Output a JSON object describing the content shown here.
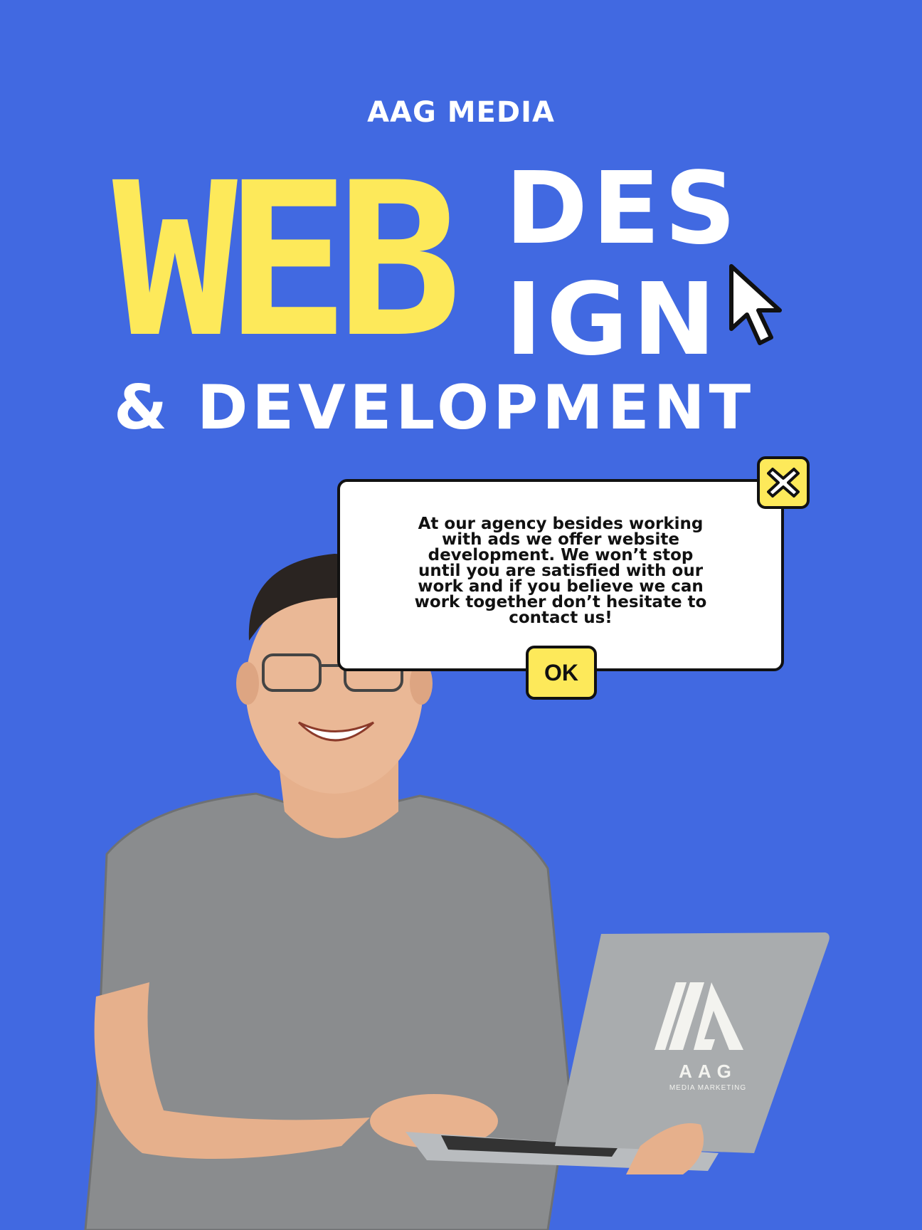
{
  "brand": "AAG MEDIA",
  "headline": {
    "word1": "WEB",
    "word2_part1": "DES",
    "word2_part2": "IGN",
    "line3": "& DEVELOPMENT"
  },
  "dialog": {
    "message": "At our agency besides working with ads we offer website development. We won’t stop until you are satisfied with our work and if you believe we can work together don’t hesitate to contact us!",
    "ok_label": "OK",
    "close_icon": "close-x-icon"
  },
  "laptop_logo": {
    "name": "AAG",
    "tagline": "MEDIA MARKETING"
  },
  "colors": {
    "background": "#4169e1",
    "accent_yellow": "#fde95a",
    "text_white": "#ffffff",
    "outline": "#111111"
  }
}
